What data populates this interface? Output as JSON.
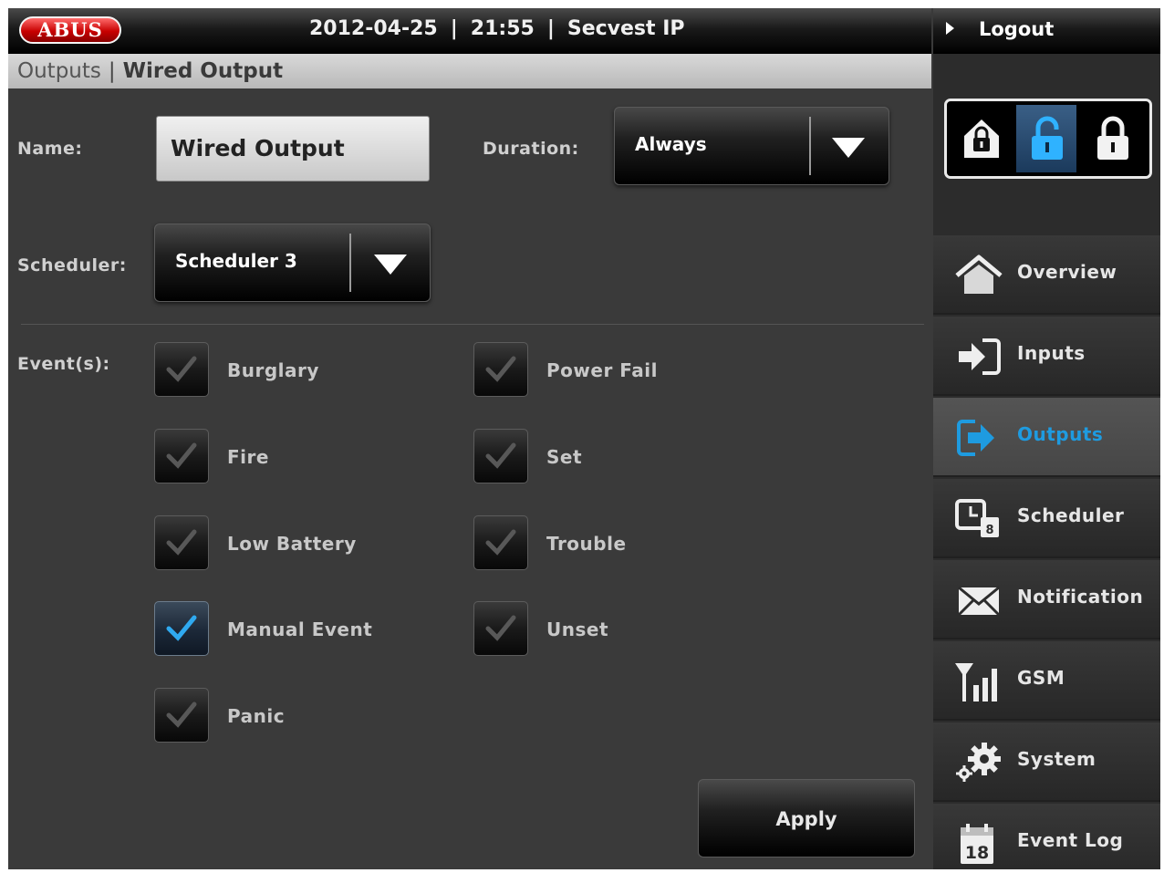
{
  "header": {
    "logo_text": "ABUS",
    "date": "2012-04-25",
    "time": "21:55",
    "system_name": "Secvest IP",
    "logout_label": "Logout"
  },
  "breadcrumb": {
    "parent": "Outputs",
    "separator": "|",
    "current": "Wired Output"
  },
  "form": {
    "name_label": "Name:",
    "name_value": "Wired Output",
    "duration_label": "Duration:",
    "duration_value": "Always",
    "scheduler_label": "Scheduler:",
    "scheduler_value": "Scheduler 3",
    "events_label": "Event(s):",
    "events": [
      {
        "label": "Burglary",
        "checked": false
      },
      {
        "label": "Fire",
        "checked": false
      },
      {
        "label": "Low Battery",
        "checked": false
      },
      {
        "label": "Manual Event",
        "checked": true
      },
      {
        "label": "Panic",
        "checked": false
      },
      {
        "label": "Power Fail",
        "checked": false
      },
      {
        "label": "Set",
        "checked": false
      },
      {
        "label": "Trouble",
        "checked": false
      },
      {
        "label": "Unset",
        "checked": false
      }
    ],
    "apply_label": "Apply"
  },
  "mode_selector": {
    "modes": [
      "partset-lock-icon",
      "unset-lock-icon",
      "fullset-lock-icon"
    ],
    "active": "unset-lock-icon"
  },
  "nav": {
    "items": [
      {
        "label": "Overview",
        "icon": "house-icon",
        "active": false
      },
      {
        "label": "Inputs",
        "icon": "input-arrow-icon",
        "active": false
      },
      {
        "label": "Outputs",
        "icon": "output-arrow-icon",
        "active": true
      },
      {
        "label": "Scheduler",
        "icon": "calendar-clock-icon",
        "active": false
      },
      {
        "label": "Notification",
        "icon": "envelope-icon",
        "active": false
      },
      {
        "label": "GSM",
        "icon": "signal-icon",
        "active": false
      },
      {
        "label": "System",
        "icon": "gears-icon",
        "active": false
      },
      {
        "label": "Event Log",
        "icon": "calendar-icon",
        "active": false
      }
    ],
    "accent_color": "#1e9be0",
    "event_log_calendar_day": "18"
  }
}
